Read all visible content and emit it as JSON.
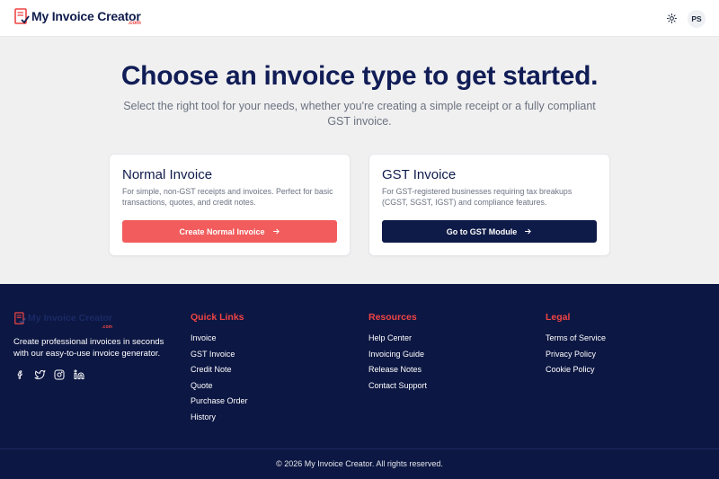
{
  "header": {
    "logo_text": "My Invoice Creator",
    "logo_suffix": ".com",
    "avatar_initials": "PS",
    "theme_icon": "sun-icon"
  },
  "hero": {
    "title": "Choose an invoice type to get started.",
    "subtitle": "Select the right tool for your needs, whether you're creating a simple receipt or a fully compliant GST invoice."
  },
  "cards": [
    {
      "title": "Normal Invoice",
      "description": "For simple, non-GST receipts and invoices. Perfect for basic transactions, quotes, and credit notes.",
      "button_label": "Create Normal Invoice",
      "button_color": "#f25c5c"
    },
    {
      "title": "GST Invoice",
      "description": "For GST-registered businesses requiring tax breakups (CGST, SGST, IGST) and compliance features.",
      "button_label": "Go to GST Module",
      "button_color": "#0e1a47"
    }
  ],
  "footer": {
    "logo_text": "My Invoice Creator",
    "logo_suffix": ".com",
    "tagline": "Create professional invoices in seconds with our easy-to-use invoice generator.",
    "socials": [
      "facebook-icon",
      "twitter-icon",
      "instagram-icon",
      "linkedin-icon"
    ],
    "columns": [
      {
        "title": "Quick Links",
        "links": [
          "Invoice",
          "GST Invoice",
          "Credit Note",
          "Quote",
          "Purchase Order",
          "History"
        ]
      },
      {
        "title": "Resources",
        "links": [
          "Help Center",
          "Invoicing Guide",
          "Release Notes",
          "Contact Support"
        ]
      },
      {
        "title": "Legal",
        "links": [
          "Terms of Service",
          "Privacy Policy",
          "Cookie Policy"
        ]
      }
    ],
    "copyright": "© 2026 My Invoice Creator. All rights reserved."
  },
  "colors": {
    "brand_navy": "#0c1743",
    "accent_red": "#f25c5c",
    "page_bg": "#f0f0f0"
  }
}
